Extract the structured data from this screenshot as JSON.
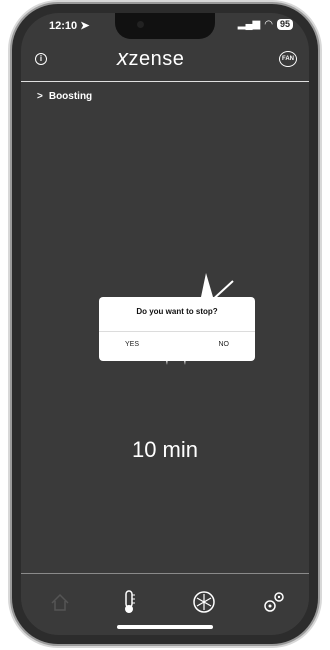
{
  "status_bar": {
    "time": "12:10",
    "battery": "95"
  },
  "header": {
    "logo_x": "x",
    "logo_rest": "zense",
    "badge": "FAN"
  },
  "mode": {
    "label": "Boosting"
  },
  "dialog": {
    "title": "Do you want to stop?",
    "yes": "YES",
    "no": "NO"
  },
  "timer": {
    "text": "10 min"
  },
  "tabs": [
    {
      "icon": "home-icon"
    },
    {
      "icon": "thermometer-icon"
    },
    {
      "icon": "fan-icon"
    },
    {
      "icon": "settings-gears-icon"
    }
  ]
}
